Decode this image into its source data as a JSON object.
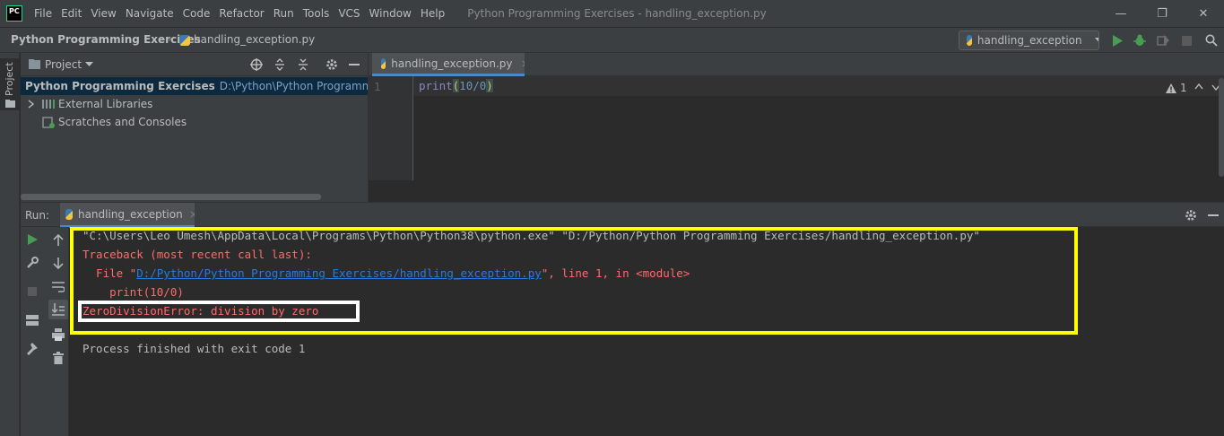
{
  "menubar": {
    "logo": "PC",
    "items": [
      "File",
      "Edit",
      "View",
      "Navigate",
      "Code",
      "Refactor",
      "Run",
      "Tools",
      "VCS",
      "Window",
      "Help"
    ],
    "title": "Python Programming Exercises - handling_exception.py",
    "minimize": "—",
    "maximize": "❐",
    "close": "✕"
  },
  "navbar": {
    "project": "Python Programming Exercises",
    "separator": "›",
    "file": "handling_exception.py",
    "run_config": "handling_exception"
  },
  "left_stripe": {
    "project_tab": "Project"
  },
  "project_panel": {
    "title": "Project",
    "tree": [
      {
        "label": "Python Programming Exercises",
        "path": "D:\\Python\\Python Programmin"
      },
      {
        "label": "External Libraries"
      },
      {
        "label": "Scratches and Consoles"
      }
    ]
  },
  "editor": {
    "tab_label": "handling_exception.py",
    "line_number": "1",
    "code": {
      "fn": "print",
      "open": "(",
      "args": "10/0",
      "close": ")"
    },
    "warning_count": "1"
  },
  "run_panel": {
    "label": "Run:",
    "tab_label": "handling_exception",
    "console": {
      "cmd": "\"C:\\Users\\Leo Umesh\\AppData\\Local\\Programs\\Python\\Python38\\python.exe\" \"D:/Python/Python Programming Exercises/handling_exception.py\"",
      "traceback": "Traceback (most recent call last):",
      "file_prefix": "  File \"",
      "file_link": "D:/Python/Python Programming Exercises/handling_exception.py",
      "file_suffix": "\", line 1, in <module>",
      "code_line": "    print(10/0)",
      "error": "ZeroDivisionError: division by zero",
      "finished": "Process finished with exit code 1"
    }
  },
  "colors": {
    "background": "#2b2b2b",
    "panel": "#3c3f41",
    "selection": "#0d293e",
    "error_text": "#ff6b68",
    "link": "#287bde",
    "highlight_box": "#ffff00",
    "run_green": "#499c54"
  }
}
